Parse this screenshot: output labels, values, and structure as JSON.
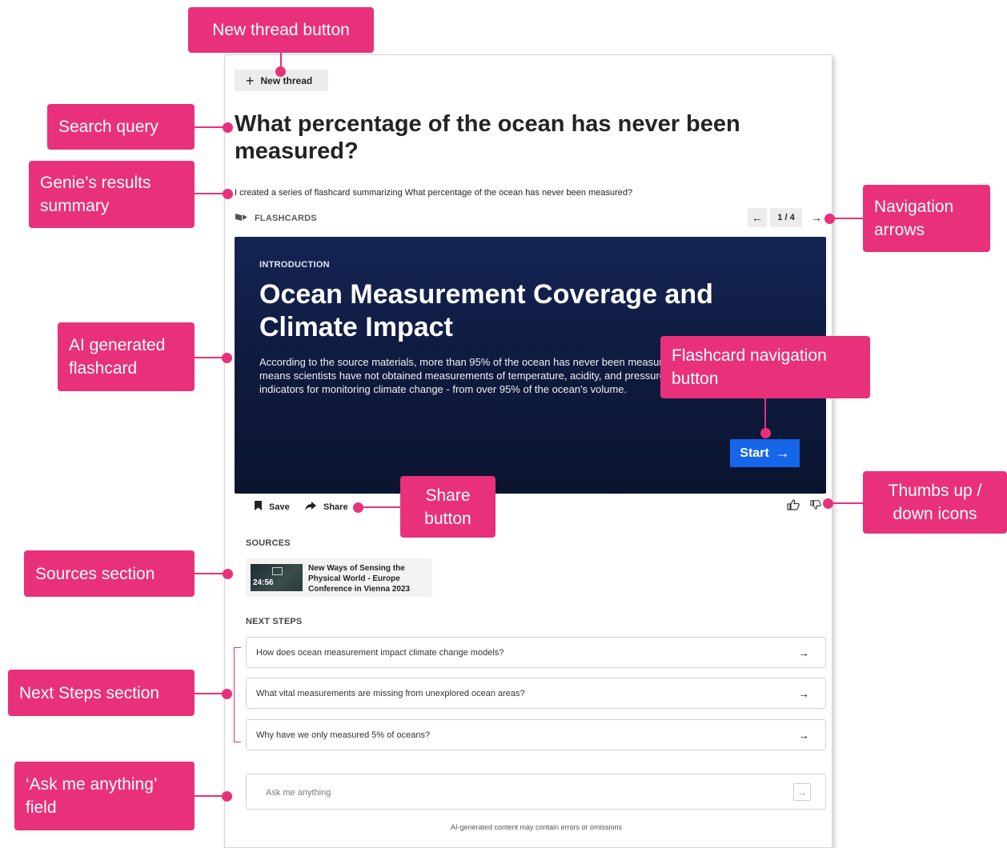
{
  "thread": {
    "new_thread_label": "New thread",
    "query": "What percentage of the ocean has never been measured?",
    "summary": "I created a series of flashcard summarizing What percentage of the ocean has never been measured?"
  },
  "flashcards": {
    "label": "FLASHCARDS",
    "page_indicator": "1 / 4",
    "section": "INTRODUCTION",
    "title": "Ocean Measurement Coverage and Climate Impact",
    "body": "According to the source materials, more than 95% of the ocean has never been measured. This means scientists have not obtained measurements of temperature, acidity, and pressure - vital indicators for monitoring climate change - from over 95% of the ocean's volume.",
    "start_label": "Start",
    "card_color": "#142453",
    "start_color": "#1566e8"
  },
  "actions": {
    "save_label": "Save",
    "share_label": "Share"
  },
  "sources": {
    "heading": "SOURCES",
    "items": [
      {
        "duration": "24:56",
        "title": "New Ways of Sensing the Physical World - Europe Conference in Vienna 2023"
      }
    ]
  },
  "next_steps": {
    "heading": "NEXT STEPS",
    "items": [
      "How does ocean measurement impact climate change models?",
      "What vital measurements are missing from unexplored ocean areas?",
      "Why have we only measured 5% of oceans?"
    ]
  },
  "ask": {
    "placeholder": "Ask me anything",
    "disclaimer": "AI-generated content may contain errors or omissions"
  },
  "callouts": {
    "color": "#e8317a",
    "new_thread": "New thread button",
    "search_query": "Search  query",
    "summary": "Genie’s results summary",
    "navigation": "Navigation arrows",
    "flashcard": "AI generated flashcard",
    "flashcard_nav": "Flashcard navigation button",
    "share": "Share button",
    "thumbs": "Thumbs up / down icons",
    "sources": "Sources section",
    "next_steps": "Next Steps section",
    "ask": "‘Ask me anything’ field"
  }
}
